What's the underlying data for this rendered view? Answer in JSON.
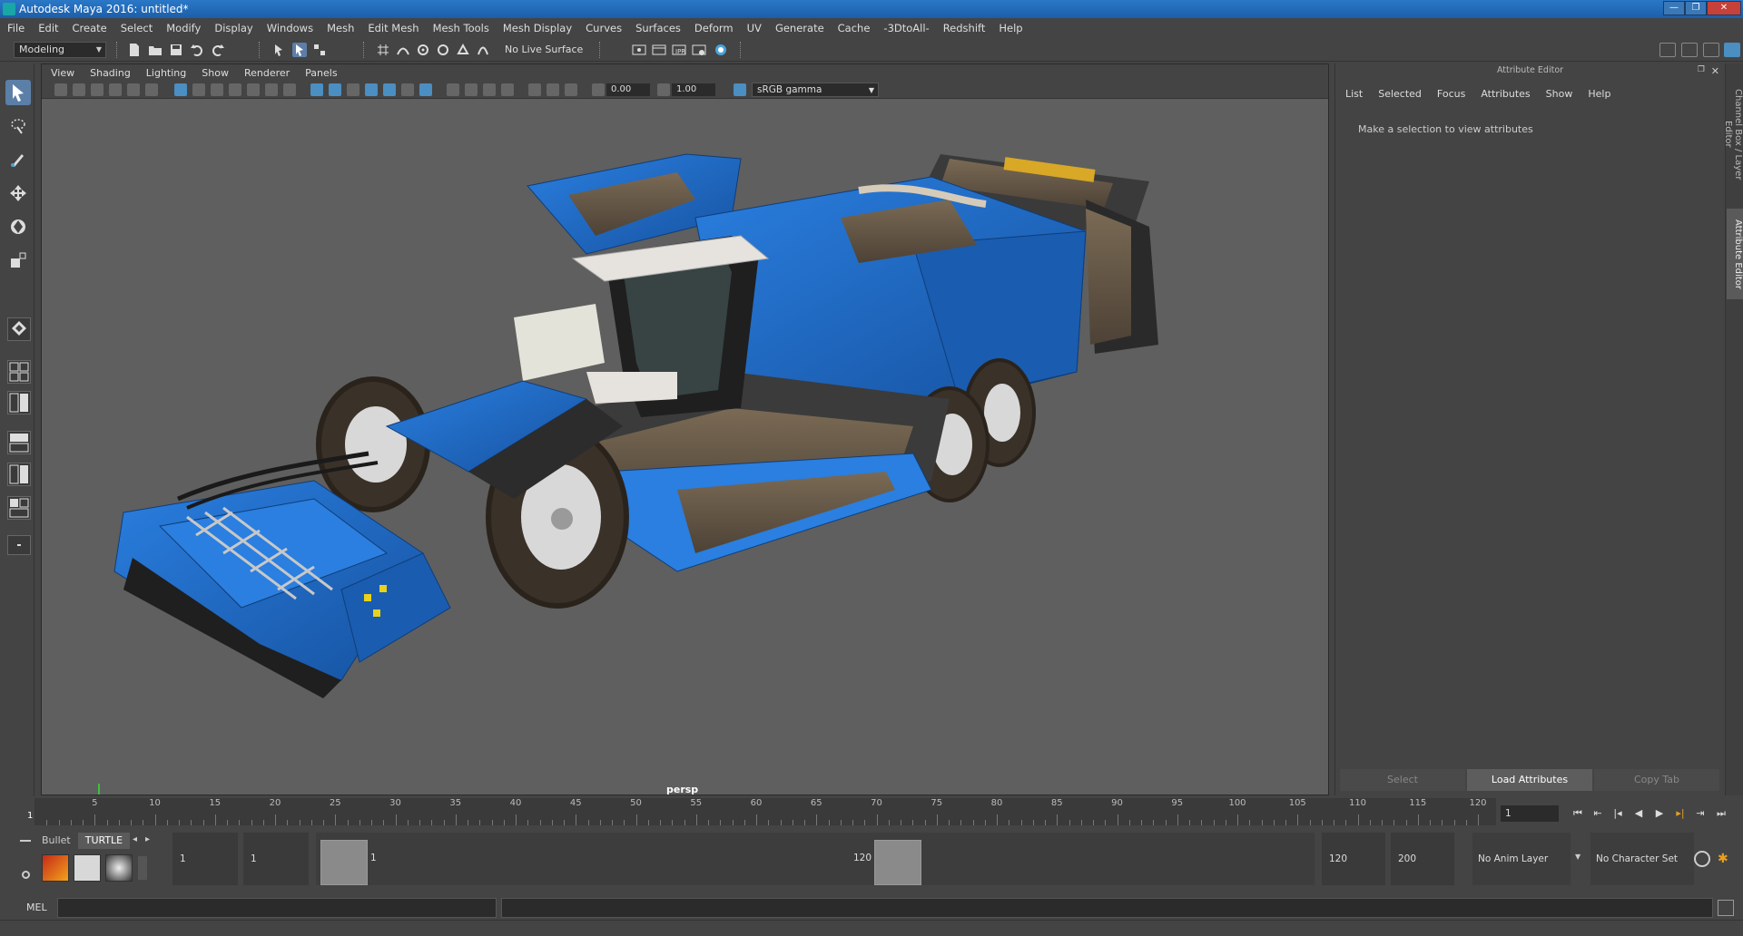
{
  "window": {
    "title": "Autodesk Maya 2016: untitled*",
    "min_glyph": "—",
    "max_glyph": "❐",
    "close_glyph": "✕"
  },
  "menubar": {
    "items": [
      "File",
      "Edit",
      "Create",
      "Select",
      "Modify",
      "Display",
      "Windows",
      "Mesh",
      "Edit Mesh",
      "Mesh Tools",
      "Mesh Display",
      "Curves",
      "Surfaces",
      "Deform",
      "UV",
      "Generate",
      "Cache",
      "-3DtoAll-",
      "Redshift",
      "Help"
    ]
  },
  "statusline": {
    "mode": "Modeling",
    "live_surface": "No Live Surface"
  },
  "viewport": {
    "menu": [
      "View",
      "Shading",
      "Lighting",
      "Show",
      "Renderer",
      "Panels"
    ],
    "exposure": "0.00",
    "gamma": "1.00",
    "color_space": "sRGB gamma",
    "camera": "persp",
    "model_colors": {
      "body": "#1f6fd1",
      "body_dark": "#175aa8",
      "tire": "#3a3128",
      "rim": "#d8d8d8",
      "cab_roof": "#e6e2de",
      "metal": "#3b3b3b"
    }
  },
  "attribute_editor": {
    "title": "Attribute Editor",
    "menu": [
      "List",
      "Selected",
      "Focus",
      "Attributes",
      "Show",
      "Help"
    ],
    "message": "Make a selection to view attributes",
    "buttons": {
      "select": "Select",
      "load": "Load Attributes",
      "copy": "Copy Tab"
    }
  },
  "side_tabs": {
    "channel_box": "Channel Box / Layer Editor",
    "attribute_editor": "Attribute Editor"
  },
  "timeslider": {
    "ticks": [
      "5",
      "10",
      "15",
      "20",
      "25",
      "30",
      "35",
      "40",
      "45",
      "50",
      "55",
      "60",
      "65",
      "70",
      "75",
      "80",
      "85",
      "90",
      "95",
      "100",
      "105",
      "110",
      "115",
      "120"
    ],
    "current_frame": "1",
    "frame_marker": "1",
    "max_frame": 120
  },
  "rangebar": {
    "shelf_tabs": [
      "Bullet",
      "TURTLE"
    ],
    "start_time": "1",
    "playback_start": "1",
    "range_start_label": "1",
    "range_end_label": "120",
    "playback_end": "120",
    "end_time": "200",
    "anim_layer": "No Anim Layer",
    "character_set": "No Character Set"
  },
  "cmdline": {
    "label": "MEL"
  }
}
